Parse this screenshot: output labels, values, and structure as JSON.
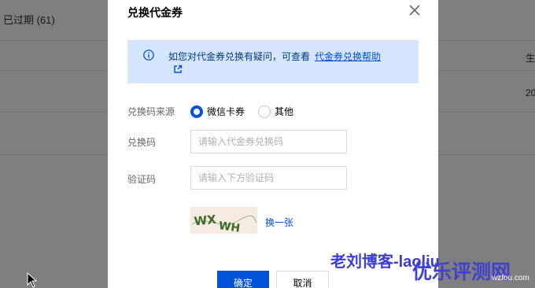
{
  "background": {
    "tab_label": "已过期 (61)",
    "col_header_fragment": "生",
    "cell_fragment": "20"
  },
  "dialog": {
    "title": "兑换代金券",
    "close_icon": "close-icon",
    "info": {
      "text": "如您对代金券兑换有疑问，可查看",
      "link_label": "代金券兑换帮助",
      "info_icon": "info-circle-icon",
      "link_icon": "external-link-icon"
    },
    "source": {
      "label": "兑换码来源",
      "options": [
        "微信卡券",
        "其他"
      ],
      "selected": "微信卡券"
    },
    "code": {
      "label": "兑换码",
      "placeholder": "请输入代金券兑换码",
      "value": ""
    },
    "captcha": {
      "label": "验证码",
      "placeholder": "请输入下方验证码",
      "value": "",
      "image_text": "WXWH",
      "refresh_label": "换一张"
    },
    "buttons": {
      "confirm": "确定",
      "cancel": "取消"
    }
  },
  "watermarks": {
    "blog": "老刘博客-laoliu",
    "site": "优乐评测网",
    "domain": "wzfou.com"
  },
  "colors": {
    "primary": "#0052d9",
    "info_bg": "#d5e5ff",
    "overlay": "rgba(0,0,0,0.5)"
  }
}
